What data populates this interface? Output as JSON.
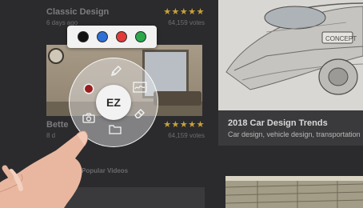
{
  "cards": [
    {
      "title": "Classic Design",
      "meta": "6 days ago",
      "stars": "★★★★★",
      "votes": "64,159 votes"
    },
    {
      "title": "Bette",
      "meta": "8 d",
      "stars": "★★★★★",
      "votes": "64,159 votes"
    }
  ],
  "section": {
    "label": "Most Popular Videos",
    "icon": "chevron-left-icon"
  },
  "feature": {
    "title": "2018 Car Design Trends",
    "subtitle": "Car design, vehicle design, transportation"
  },
  "palette": {
    "colors": [
      {
        "name": "black",
        "hex": "#111111"
      },
      {
        "name": "blue",
        "hex": "#2d6fd6"
      },
      {
        "name": "red",
        "hex": "#e23a3a"
      },
      {
        "name": "green",
        "hex": "#2aa84a"
      }
    ]
  },
  "radial_menu": {
    "center_label": "EZ",
    "selected_color": "#9b1c1c",
    "tools": [
      {
        "icon": "pen-icon"
      },
      {
        "icon": "signature-icon"
      },
      {
        "icon": "eraser-icon"
      },
      {
        "icon": "folder-icon"
      },
      {
        "icon": "camera-icon"
      },
      {
        "icon": "color-dot-icon"
      }
    ]
  },
  "colors": {
    "background": "#2b2b2d",
    "star": "#c9a13a",
    "accent_text": "#d8d8d8"
  }
}
